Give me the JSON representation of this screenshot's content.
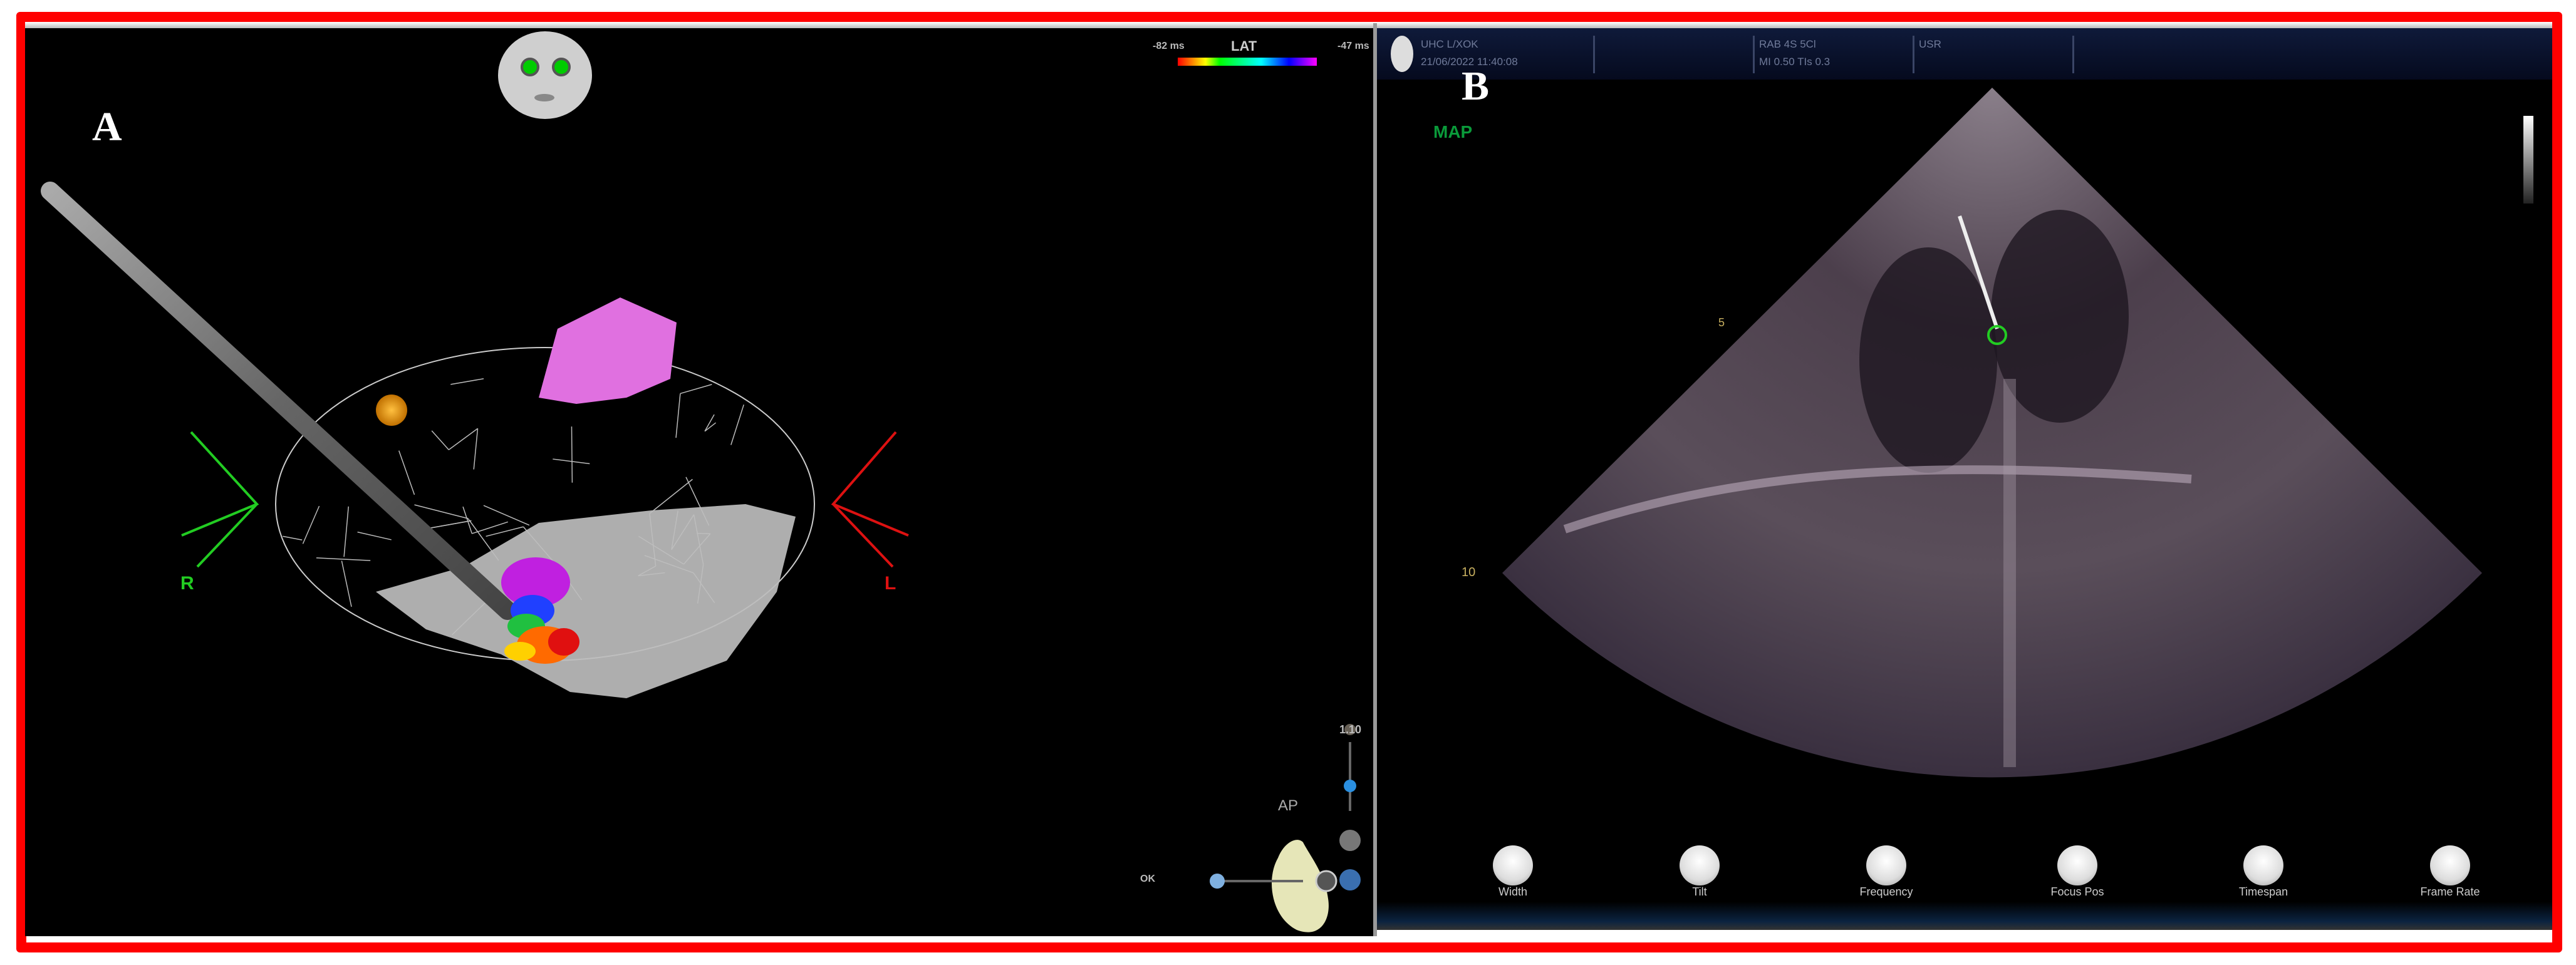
{
  "panel_a": {
    "label": "A",
    "legend": {
      "title": "LAT",
      "min": "-82 ms",
      "max": "-47 ms"
    },
    "markers": {
      "right": "R",
      "left": "L"
    },
    "orientation": "AP",
    "zoom_value": "1.10",
    "ok_label": "OK"
  },
  "panel_b": {
    "label": "B",
    "header": {
      "line1": "UHC L/XOK",
      "line2": "21/06/2022 11:40:08",
      "probe1": "RAB 4S 5Cl",
      "probe2": "MI 0.50 TIs 0.3",
      "user": "USR"
    },
    "mode_label": "MAP",
    "depth_marks": [
      "5",
      "10"
    ],
    "controls": [
      "Width",
      "Tilt",
      "Frequency",
      "Focus Pos",
      "Timespan",
      "Frame Rate"
    ]
  },
  "colors": {
    "frame": "#ff0000",
    "r_marker": "#22cc22",
    "l_marker": "#dd1111",
    "mesh_pink": "#e070e0"
  }
}
